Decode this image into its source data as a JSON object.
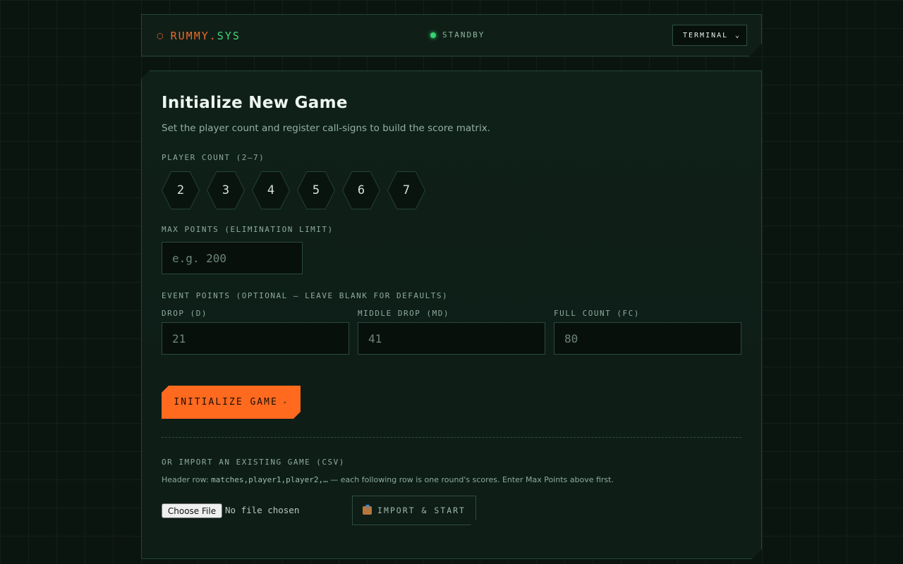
{
  "header": {
    "brand_part1": "RUMMY.",
    "brand_part2": "SYS",
    "status": "STANDBY",
    "theme_select": "TERMINAL"
  },
  "main": {
    "title": "Initialize New Game",
    "subtitle": "Set the player count and register call-signs to build the score matrix.",
    "player_count_label": "PLAYER COUNT (2–7)",
    "player_counts": [
      "2",
      "3",
      "4",
      "5",
      "6",
      "7"
    ],
    "max_points_label": "MAX POINTS (ELIMINATION LIMIT)",
    "max_points_placeholder": "e.g. 200",
    "event_points_label": "EVENT POINTS (OPTIONAL — LEAVE BLANK FOR DEFAULTS)",
    "drop_label": "DROP (D)",
    "drop_placeholder": "21",
    "middle_drop_label": "MIDDLE DROP (MD)",
    "middle_drop_placeholder": "41",
    "full_count_label": "FULL COUNT (FC)",
    "full_count_placeholder": "80",
    "init_button": "INITIALIZE GAME",
    "init_button_icon": "▹",
    "import_label": "OR IMPORT AN EXISTING GAME (CSV)",
    "help_prefix": "Header row: ",
    "help_code": "matches,player1,player2,…",
    "help_suffix": " — each following row is one round's scores. Enter Max Points above first.",
    "choose_file": "Choose File",
    "file_status": "No file chosen",
    "import_button": "IMPORT & START"
  },
  "colors": {
    "accent": "#ff6a1f",
    "status_ok": "#34d46f",
    "brand_green": "#41d27c"
  }
}
